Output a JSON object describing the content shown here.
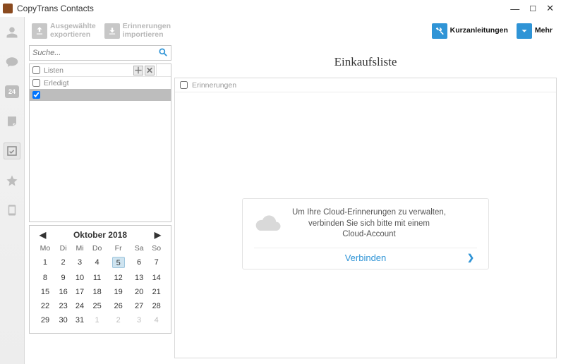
{
  "window": {
    "title": "CopyTrans Contacts"
  },
  "toolbar": {
    "export": {
      "line1": "Ausgewählte",
      "line2": "exportieren"
    },
    "import": {
      "line1": "Erinnerungen",
      "line2": "importieren"
    },
    "guides": "Kurzanleitungen",
    "more": "Mehr"
  },
  "sidebar": {
    "calendar_label": "24"
  },
  "search": {
    "placeholder": "Suche..."
  },
  "lists": {
    "header": "Listen",
    "items": [
      {
        "label": "Erledigt",
        "checked": false,
        "selected": false
      },
      {
        "label": "",
        "checked": true,
        "selected": true
      }
    ]
  },
  "calendar": {
    "title": "Oktober 2018",
    "weekdays": [
      "Mo",
      "Di",
      "Mi",
      "Do",
      "Fr",
      "Sa",
      "So"
    ],
    "selected_day": 5,
    "weeks": [
      [
        {
          "d": 1
        },
        {
          "d": 2
        },
        {
          "d": 3
        },
        {
          "d": 4
        },
        {
          "d": 5,
          "sel": true
        },
        {
          "d": 6
        },
        {
          "d": 7
        }
      ],
      [
        {
          "d": 8
        },
        {
          "d": 9
        },
        {
          "d": 10
        },
        {
          "d": 11
        },
        {
          "d": 12
        },
        {
          "d": 13
        },
        {
          "d": 14
        }
      ],
      [
        {
          "d": 15
        },
        {
          "d": 16
        },
        {
          "d": 17
        },
        {
          "d": 18
        },
        {
          "d": 19
        },
        {
          "d": 20
        },
        {
          "d": 21
        }
      ],
      [
        {
          "d": 22
        },
        {
          "d": 23
        },
        {
          "d": 24
        },
        {
          "d": 25
        },
        {
          "d": 26
        },
        {
          "d": 27
        },
        {
          "d": 28
        }
      ],
      [
        {
          "d": 29
        },
        {
          "d": 30
        },
        {
          "d": 31
        },
        {
          "d": 1,
          "dim": true
        },
        {
          "d": 2,
          "dim": true
        },
        {
          "d": 3,
          "dim": true
        },
        {
          "d": 4,
          "dim": true
        }
      ]
    ]
  },
  "page": {
    "title": "Einkaufsliste"
  },
  "reminders": {
    "header": "Erinnerungen"
  },
  "cloud": {
    "line1": "Um Ihre Cloud-Erinnerungen zu verwalten,",
    "line2": "verbinden Sie sich bitte mit einem",
    "line3": "Cloud-Account",
    "connect": "Verbinden"
  }
}
